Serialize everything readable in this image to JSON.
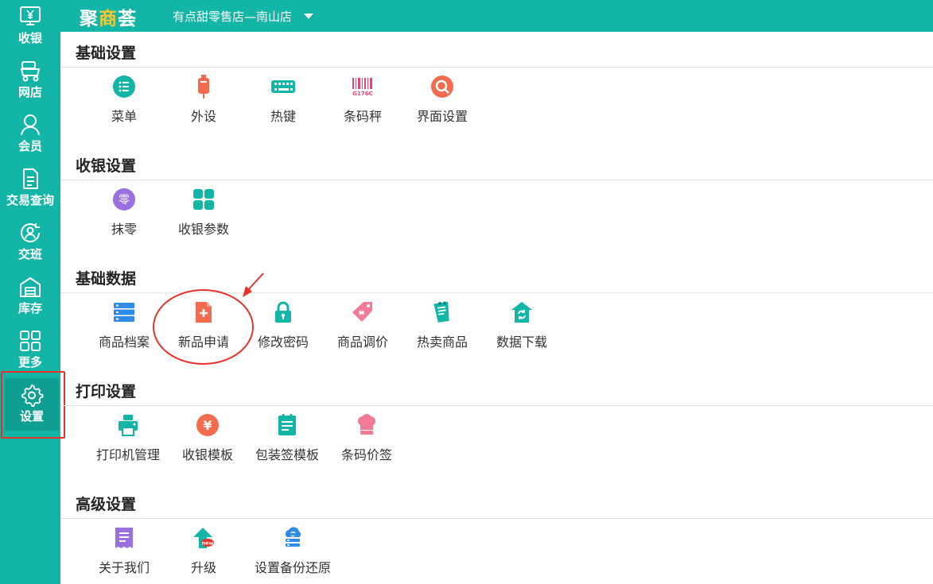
{
  "app": {
    "logo": {
      "part1": "聚",
      "accent": "商",
      "part2": "荟"
    },
    "store": "有点甜零售店—南山店"
  },
  "sidebar": {
    "items": [
      {
        "label": "收银",
        "icon": "cashier-monitor-icon"
      },
      {
        "label": "网店",
        "icon": "online-store-icon"
      },
      {
        "label": "会员",
        "icon": "member-icon"
      },
      {
        "label": "交易查询",
        "icon": "transaction-query-icon"
      },
      {
        "label": "交班",
        "icon": "shift-handover-icon"
      },
      {
        "label": "库存",
        "icon": "inventory-icon"
      },
      {
        "label": "更多",
        "icon": "more-grid-icon"
      },
      {
        "label": "设置",
        "icon": "gear-icon",
        "active": true
      }
    ]
  },
  "sections": [
    {
      "title": "基础设置",
      "items": [
        {
          "label": "菜单",
          "icon": "menu-list-icon"
        },
        {
          "label": "外设",
          "icon": "peripheral-device-icon"
        },
        {
          "label": "热键",
          "icon": "keyboard-icon"
        },
        {
          "label": "条码秤",
          "icon": "barcode-scale-icon",
          "icon_text": "G176C"
        },
        {
          "label": "界面设置",
          "icon": "interface-settings-icon"
        }
      ]
    },
    {
      "title": "收银设置",
      "items": [
        {
          "label": "抹零",
          "icon": "round-off-icon",
          "icon_text": "零"
        },
        {
          "label": "收银参数",
          "icon": "cashier-params-grid-icon"
        }
      ]
    },
    {
      "title": "基础数据",
      "items": [
        {
          "label": "商品档案",
          "icon": "product-archive-icon"
        },
        {
          "label": "新品申请",
          "icon": "new-product-apply-icon"
        },
        {
          "label": "修改密码",
          "icon": "lock-icon"
        },
        {
          "label": "商品调价",
          "icon": "price-tag-icon"
        },
        {
          "label": "热卖商品",
          "icon": "hot-products-icon"
        },
        {
          "label": "数据下载",
          "icon": "data-download-icon"
        }
      ]
    },
    {
      "title": "打印设置",
      "items": [
        {
          "label": "打印机管理",
          "icon": "printer-icon"
        },
        {
          "label": "收银模板",
          "icon": "yuan-template-icon",
          "icon_text": "¥"
        },
        {
          "label": "包装签模板",
          "icon": "package-label-icon"
        },
        {
          "label": "条码价签",
          "icon": "barcode-price-label-icon"
        }
      ]
    },
    {
      "title": "高级设置",
      "items": [
        {
          "label": "关于我们",
          "icon": "about-us-icon"
        },
        {
          "label": "升级",
          "icon": "upgrade-icon",
          "icon_text": "new"
        },
        {
          "label": "设置备份还原",
          "icon": "backup-restore-icon"
        }
      ]
    }
  ],
  "colors": {
    "brand": "#13b5a6",
    "annotation": "#e8312a"
  }
}
